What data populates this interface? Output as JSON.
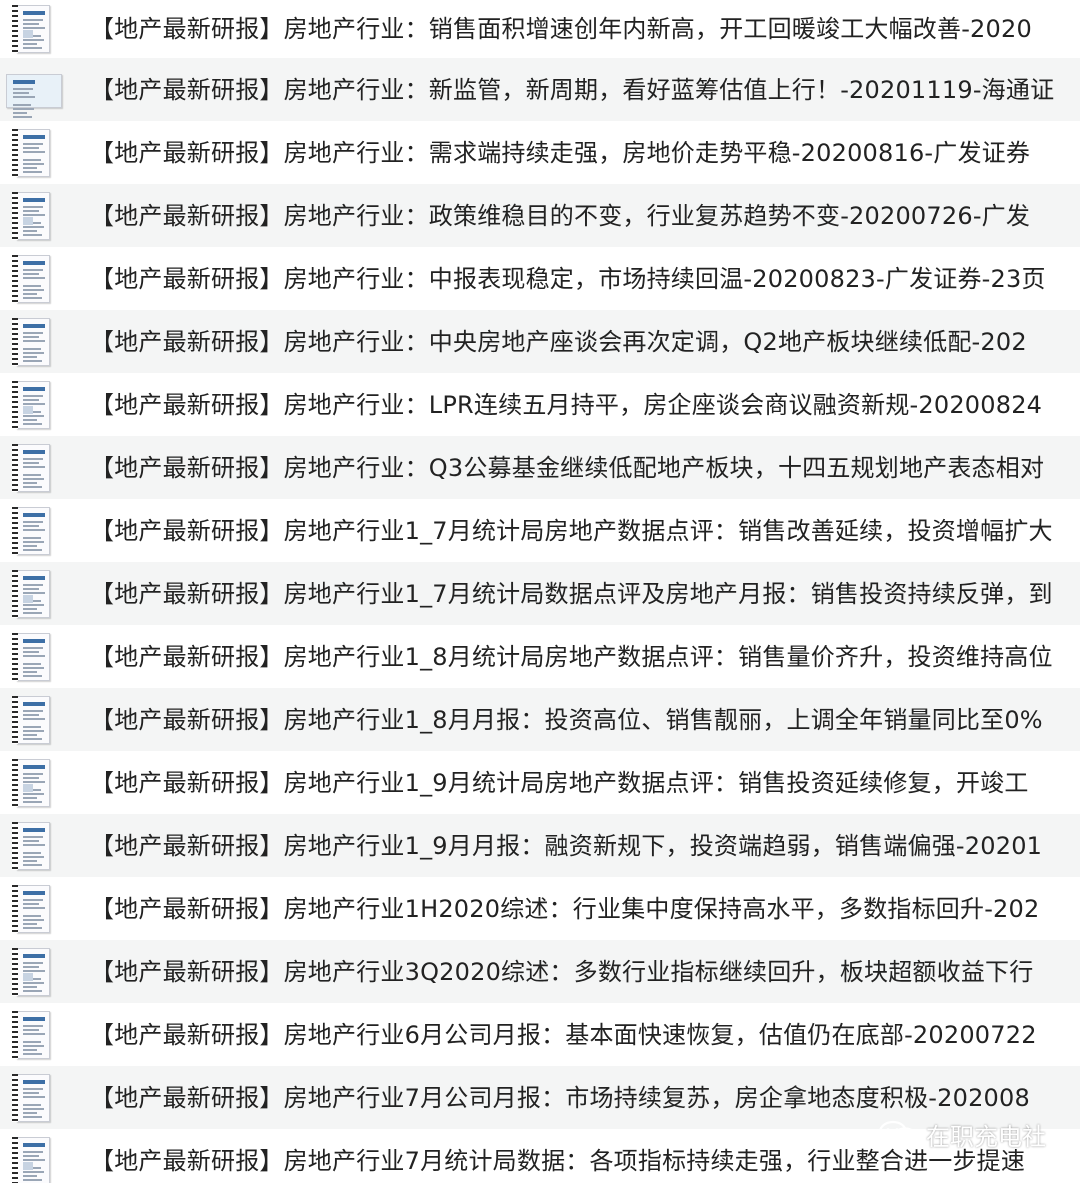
{
  "files": [
    {
      "name": "【地产最新研报】房地产行业：销售面积增速创年内新高，开工回暖竣工大幅改善-2020"
    },
    {
      "name": "【地产最新研报】房地产行业：新监管，新周期，看好蓝筹估值上行！-20201119-海通证"
    },
    {
      "name": "【地产最新研报】房地产行业：需求端持续走强，房地价走势平稳-20200816-广发证券"
    },
    {
      "name": "【地产最新研报】房地产行业：政策维稳目的不变，行业复苏趋势不变-20200726-广发"
    },
    {
      "name": "【地产最新研报】房地产行业：中报表现稳定，市场持续回温-20200823-广发证券-23页"
    },
    {
      "name": "【地产最新研报】房地产行业：中央房地产座谈会再次定调，Q2地产板块继续低配-202"
    },
    {
      "name": "【地产最新研报】房地产行业：LPR连续五月持平，房企座谈会商议融资新规-20200824"
    },
    {
      "name": "【地产最新研报】房地产行业：Q3公募基金继续低配地产板块，十四五规划地产表态相对"
    },
    {
      "name": "【地产最新研报】房地产行业1_7月统计局房地产数据点评：销售改善延续，投资增幅扩大"
    },
    {
      "name": "【地产最新研报】房地产行业1_7月统计局数据点评及房地产月报：销售投资持续反弹，到"
    },
    {
      "name": "【地产最新研报】房地产行业1_8月统计局房地产数据点评：销售量价齐升，投资维持高位"
    },
    {
      "name": "【地产最新研报】房地产行业1_8月月报：投资高位、销售靓丽，上调全年销量同比至0%"
    },
    {
      "name": "【地产最新研报】房地产行业1_9月统计局房地产数据点评：销售投资延续修复，开竣工"
    },
    {
      "name": "【地产最新研报】房地产行业1_9月月报：融资新规下，投资端趋弱，销售端偏强-20201"
    },
    {
      "name": "【地产最新研报】房地产行业1H2020综述：行业集中度保持高水平，多数指标回升-202"
    },
    {
      "name": "【地产最新研报】房地产行业3Q2020综述：多数行业指标继续回升，板块超额收益下行"
    },
    {
      "name": "【地产最新研报】房地产行业6月公司月报：基本面快速恢复，估值仍在底部-20200722"
    },
    {
      "name": "【地产最新研报】房地产行业7月公司月报：市场持续复苏，房企拿地态度积极-202008"
    },
    {
      "name": "【地产最新研报】房地产行业7月统计局数据：各项指标持续走强，行业整合进一步提速"
    }
  ],
  "watermark": {
    "text": "在职充电社",
    "icon": "wechat-icon"
  }
}
